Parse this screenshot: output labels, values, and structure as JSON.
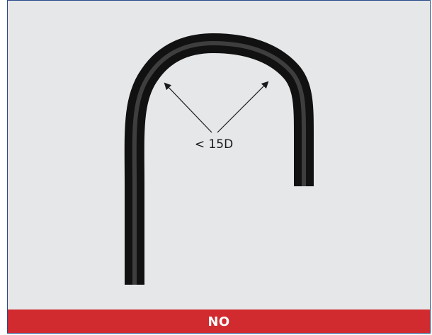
{
  "diagram": {
    "annotation": "< 15D",
    "verdict": "NO",
    "colors": {
      "background": "#e6e7e8",
      "border": "#2a4b8d",
      "verdict_bar": "#d12a2f",
      "verdict_text": "#ffffff",
      "tube": "#1b1b1b",
      "arrow": "#1a1a1a"
    },
    "tube_shape": "u-bend",
    "verdict_icon": "none"
  }
}
